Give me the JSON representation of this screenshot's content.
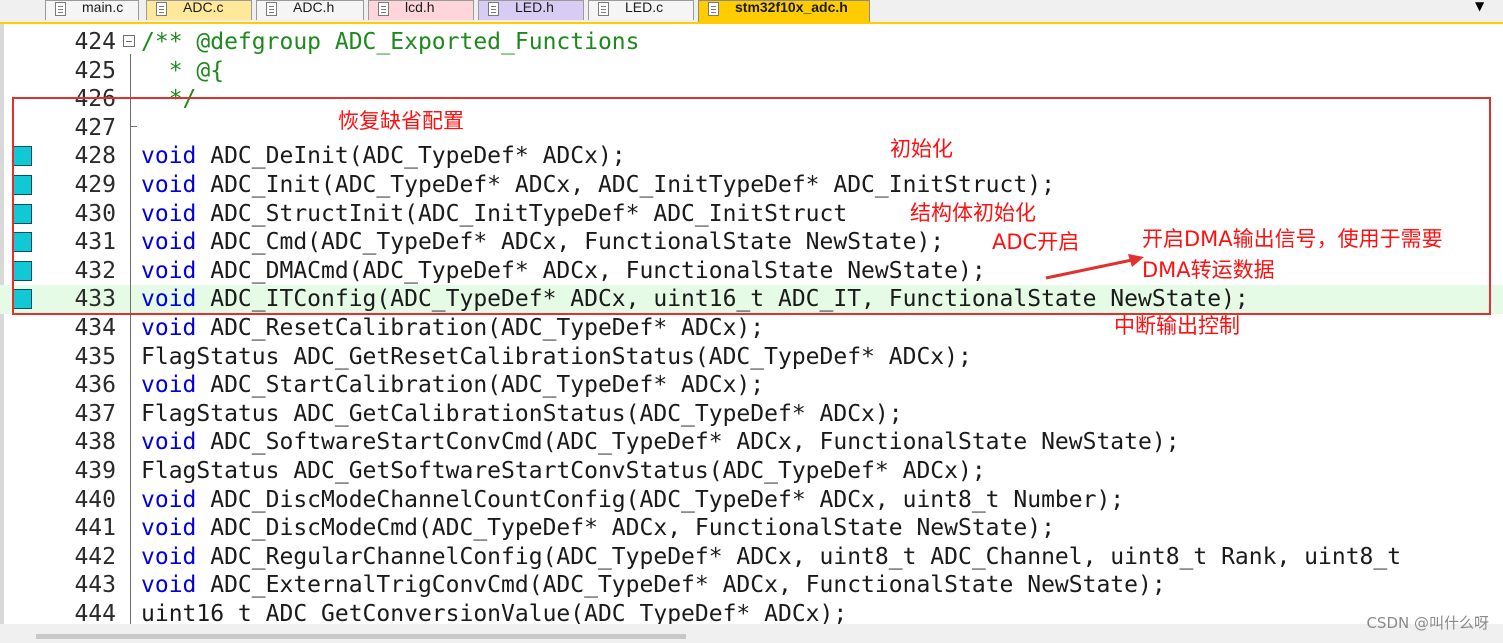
{
  "tabs": [
    {
      "label": "main.c",
      "active": false,
      "color": "#f5f5f5"
    },
    {
      "label": "ADC.c",
      "active": false,
      "color": "#ffe89a"
    },
    {
      "label": "ADC.h",
      "active": false,
      "color": "#f5f5f5"
    },
    {
      "label": "lcd.h",
      "active": false,
      "color": "#ffd5dc"
    },
    {
      "label": "LED.h",
      "active": false,
      "color": "#d8ccf5"
    },
    {
      "label": "LED.c",
      "active": false,
      "color": "#f5f5f5"
    },
    {
      "label": "stm32f10x_adc.h",
      "active": true,
      "color": "#ffcc00"
    }
  ],
  "tab_menu_icon": "dropdown-arrow-icon",
  "lines": [
    {
      "num": "424",
      "parts": [
        {
          "t": "/** @defgroup ADC_Exported_Functions",
          "c": "cm"
        }
      ]
    },
    {
      "num": "425",
      "parts": [
        {
          "t": "  * @{",
          "c": "cm"
        }
      ]
    },
    {
      "num": "426",
      "parts": [
        {
          "t": "  */",
          "c": "cm"
        }
      ]
    },
    {
      "num": "427",
      "parts": []
    },
    {
      "num": "428",
      "marker": true,
      "parts": [
        {
          "t": "void",
          "c": "kw"
        },
        {
          "t": " ADC_DeInit(ADC_TypeDef* ADCx);",
          "c": ""
        }
      ]
    },
    {
      "num": "429",
      "marker": true,
      "parts": [
        {
          "t": "void",
          "c": "kw"
        },
        {
          "t": " ADC_Init(ADC_TypeDef* ADCx, ADC_InitTypeDef* ADC_InitStruct);",
          "c": ""
        }
      ]
    },
    {
      "num": "430",
      "marker": true,
      "parts": [
        {
          "t": "void",
          "c": "kw"
        },
        {
          "t": " ADC_StructInit(ADC_InitTypeDef* ADC_InitStruct",
          "c": ""
        }
      ]
    },
    {
      "num": "431",
      "marker": true,
      "parts": [
        {
          "t": "void",
          "c": "kw"
        },
        {
          "t": " ADC_Cmd(ADC_TypeDef* ADCx, FunctionalState NewState);",
          "c": ""
        }
      ]
    },
    {
      "num": "432",
      "marker": true,
      "parts": [
        {
          "t": "void",
          "c": "kw"
        },
        {
          "t": " ADC_DMACmd(ADC_TypeDef* ADCx, FunctionalState NewState);",
          "c": ""
        }
      ]
    },
    {
      "num": "433",
      "marker": true,
      "highlight": true,
      "parts": [
        {
          "t": "void",
          "c": "kw"
        },
        {
          "t": " ADC_ITConfig(ADC_TypeDef* ADCx, uint16_t ADC_IT, FunctionalState NewState);",
          "c": ""
        }
      ]
    },
    {
      "num": "434",
      "parts": [
        {
          "t": "void",
          "c": "kw"
        },
        {
          "t": " ADC_ResetCalibration(ADC_TypeDef* ADCx);",
          "c": ""
        }
      ]
    },
    {
      "num": "435",
      "parts": [
        {
          "t": "FlagStatus ADC_GetResetCalibrationStatus(ADC_TypeDef* ADCx);",
          "c": ""
        }
      ]
    },
    {
      "num": "436",
      "parts": [
        {
          "t": "void",
          "c": "kw"
        },
        {
          "t": " ADC_StartCalibration(ADC_TypeDef* ADCx);",
          "c": ""
        }
      ]
    },
    {
      "num": "437",
      "parts": [
        {
          "t": "FlagStatus ADC_GetCalibrationStatus(ADC_TypeDef* ADCx);",
          "c": ""
        }
      ]
    },
    {
      "num": "438",
      "parts": [
        {
          "t": "void",
          "c": "kw"
        },
        {
          "t": " ADC_SoftwareStartConvCmd(ADC_TypeDef* ADCx, FunctionalState NewState);",
          "c": ""
        }
      ]
    },
    {
      "num": "439",
      "parts": [
        {
          "t": "FlagStatus ADC_GetSoftwareStartConvStatus(ADC_TypeDef* ADCx);",
          "c": ""
        }
      ]
    },
    {
      "num": "440",
      "parts": [
        {
          "t": "void",
          "c": "kw"
        },
        {
          "t": " ADC_DiscModeChannelCountConfig(ADC_TypeDef* ADCx, uint8_t Number);",
          "c": ""
        }
      ]
    },
    {
      "num": "441",
      "parts": [
        {
          "t": "void",
          "c": "kw"
        },
        {
          "t": " ADC_DiscModeCmd(ADC_TypeDef* ADCx, FunctionalState NewState);",
          "c": ""
        }
      ]
    },
    {
      "num": "442",
      "parts": [
        {
          "t": "void",
          "c": "kw"
        },
        {
          "t": " ADC_RegularChannelConfig(ADC_TypeDef* ADCx, uint8_t ADC_Channel, uint8_t Rank, uint8_t",
          "c": ""
        }
      ]
    },
    {
      "num": "443",
      "parts": [
        {
          "t": "void",
          "c": "kw"
        },
        {
          "t": " ADC_ExternalTrigConvCmd(ADC_TypeDef* ADCx, FunctionalState NewState);",
          "c": ""
        }
      ]
    },
    {
      "num": "444",
      "parts": [
        {
          "t": "uint16_t ADC_GetConversionValue(ADC_TypeDef* ADCx);",
          "c": ""
        }
      ]
    }
  ],
  "annotations": {
    "restore_default": "恢复缺省配置",
    "init": "初始化",
    "struct_init": "结构体初始化",
    "adc_enable": "ADC开启",
    "dma_line1": "开启DMA输出信号，使用于需要",
    "dma_line2": "DMA转运数据",
    "interrupt": "中断输出控制"
  },
  "watermark": "CSDN @叫什么呀",
  "colors": {
    "keyword": "#0000e0",
    "comment": "#1d8a1d",
    "annotation": "#ff1010",
    "marker": "#11c8d4",
    "highlight": "#e6fbe6"
  }
}
